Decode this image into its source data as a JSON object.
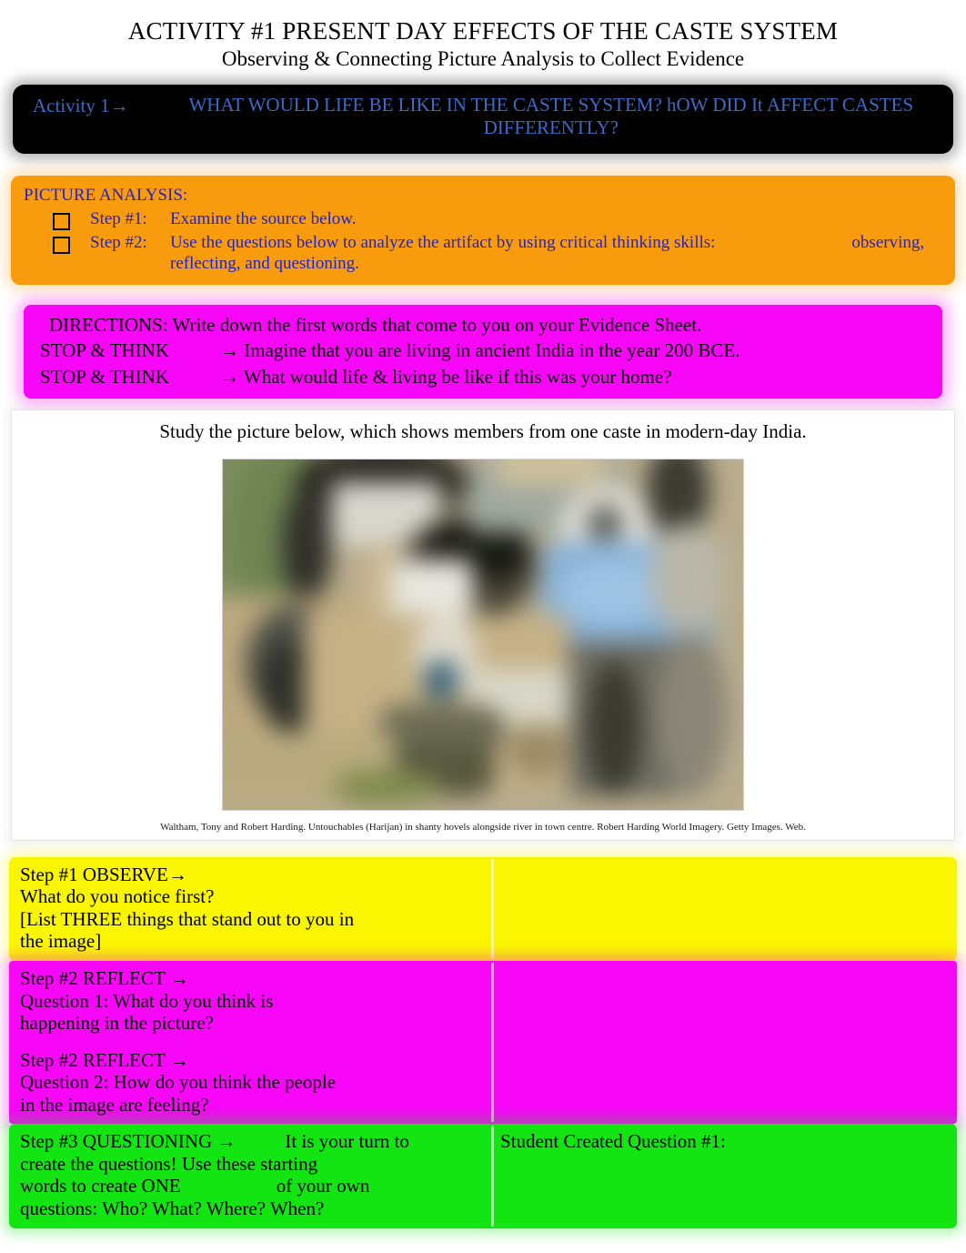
{
  "document": {
    "title_main": "ACTIVITY #1 PRESENT DAY EFFECTS OF THE CASTE SYSTEM",
    "title_sub": "Observing & Connecting Picture Analysis to Collect Evidence"
  },
  "banner": {
    "label": "Activity 1→",
    "question": "WHAT WOULD LIFE BE LIKE IN THE CASTE SYSTEM? hOW DID It AFFECT CASTES DIFFERENTLY?",
    "background_color": "#000000",
    "text_color": "#3C6BC6"
  },
  "picture_analysis": {
    "heading": "PICTURE ANALYSIS:",
    "background_color": "#F89C0E",
    "text_color": "#2222C8",
    "steps": [
      {
        "checkbox": "empty-checkbox",
        "label": "Step #1:",
        "text": "Examine the source below."
      },
      {
        "checkbox": "empty-checkbox",
        "label": "Step #2:",
        "text": "Use the questions below to analyze the artifact by using critical thinking skills:",
        "text_tail": "observing, reflecting, and questioning."
      }
    ]
  },
  "directions": {
    "background_color": "#F706F7",
    "line1": "DIRECTIONS: Write down the first words that come to you on your Evidence Sheet.",
    "stop_think_label_1": "STOP & THINK",
    "stop_think_text_1": "→ Imagine that you are living in ancient India in the year 200 BCE.",
    "stop_think_label_2": "STOP & THINK",
    "stop_think_text_2": "→ What would life & living be like if this was your home?"
  },
  "picture": {
    "lead_in": "Study the picture below, which shows members from one caste in modern-day India.",
    "caption": "Waltham, Tony and Robert Harding. Untouchables (Harijan) in shanty hovels alongside river in town centre. Robert Harding World Imagery. Getty Images. Web.",
    "alt": "blurred-photograph-of-shanty-dwellings"
  },
  "tables": {
    "observe": {
      "background_color": "#FAF500",
      "left_lines": [
        "Step #1 OBSERVE→",
        "What do you notice first?",
        "[List THREE things that stand out to you in",
        "the image]"
      ],
      "right_lines": [
        ""
      ]
    },
    "reflect_1": {
      "background_color": "#F706F7",
      "left_lines": [
        "Step #2 REFLECT →",
        "Question 1: What do you think is",
        "happening in the picture?"
      ],
      "right_lines": [
        ""
      ]
    },
    "reflect_2": {
      "background_color": "#F706F7",
      "left_lines": [
        "Step #2 REFLECT →",
        "Question 2: How do you think the people",
        "in the image are feeling?"
      ],
      "right_lines": [
        ""
      ]
    },
    "questioning": {
      "background_color": "#12E512",
      "left_line_1_a": "Step #3 QUESTIONING →",
      "left_line_1_b": "It is your turn to",
      "left_line_2": "create the questions! Use these starting",
      "left_line_3_a": "words to create ONE",
      "left_line_3_b": "of your own",
      "left_line_4": "questions: Who? What? Where? When?",
      "right_line_1": "Student Created Question #1:"
    }
  }
}
